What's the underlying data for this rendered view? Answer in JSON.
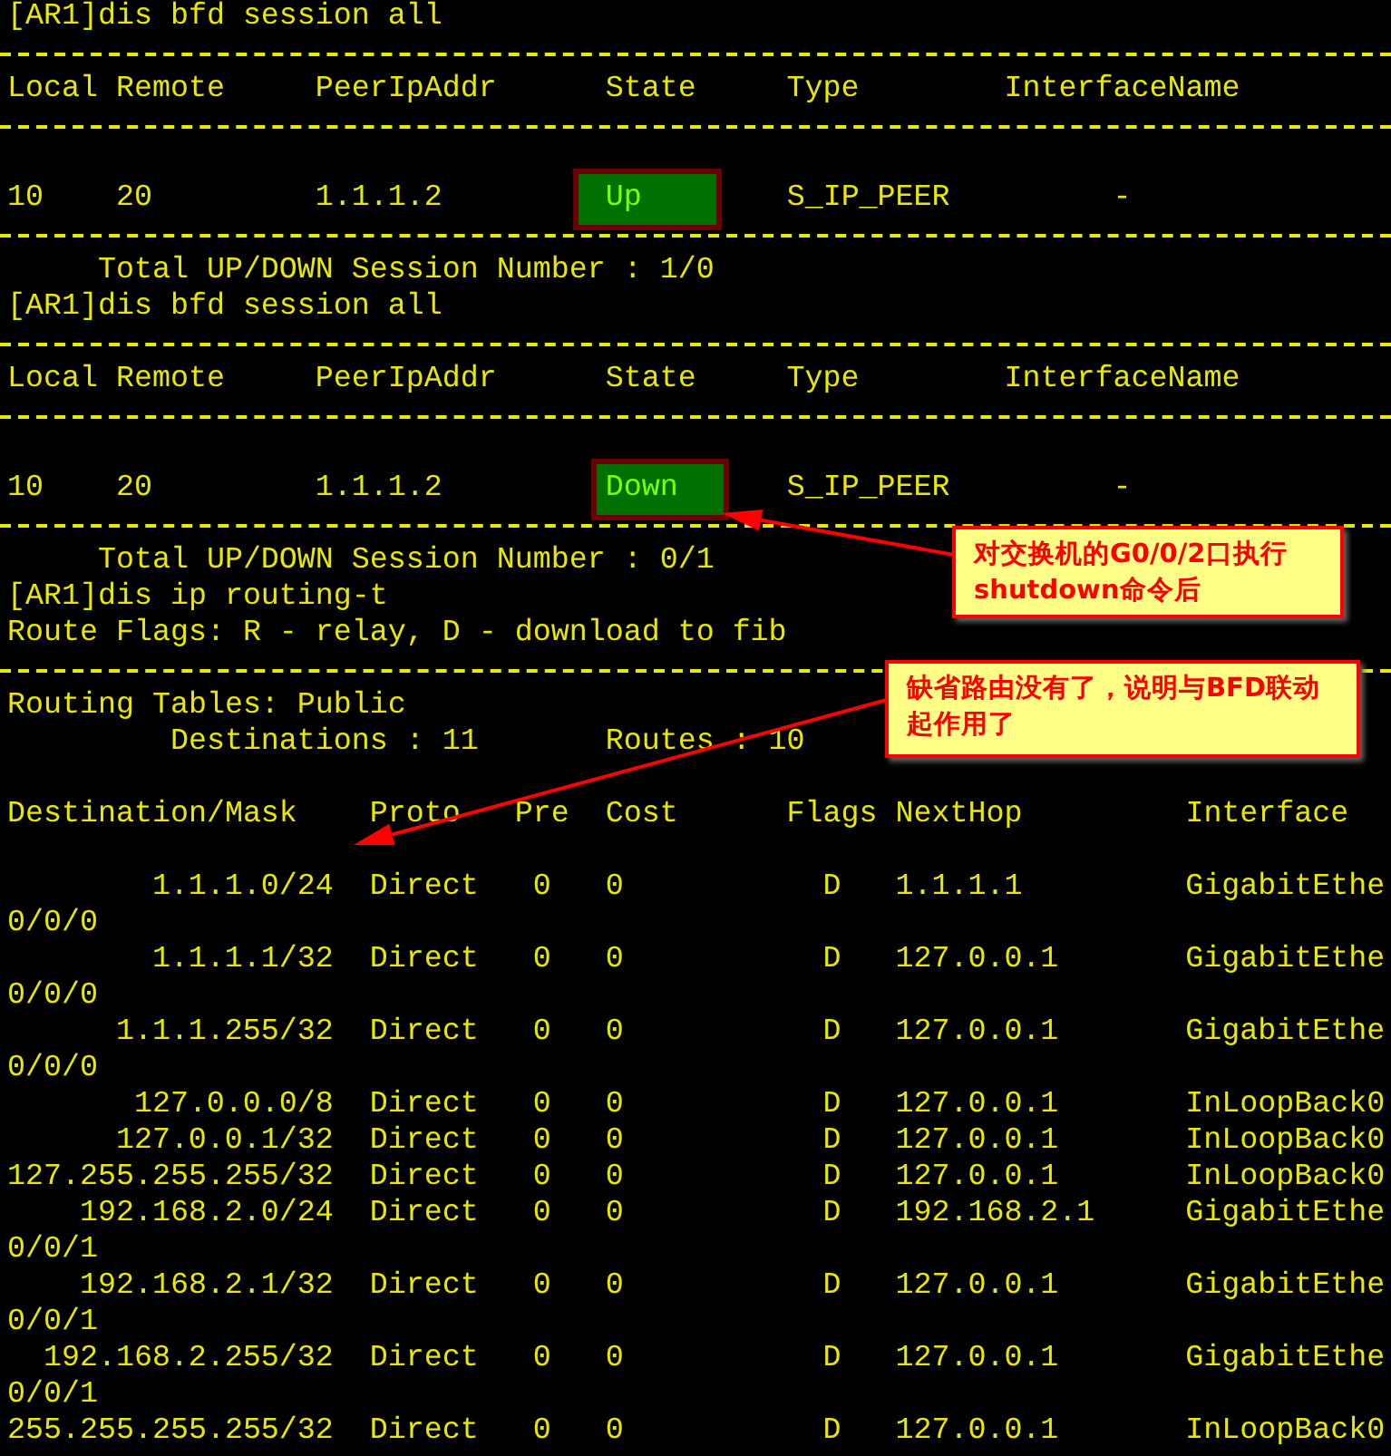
{
  "terminal": {
    "lines": [
      {
        "kind": "text",
        "text": "[AR1]dis bfd session all"
      },
      {
        "kind": "rule"
      },
      {
        "kind": "text",
        "text": "Local Remote     PeerIpAddr      State     Type        InterfaceName"
      },
      {
        "kind": "rule"
      },
      {
        "kind": "blank"
      },
      {
        "kind": "bfd_row",
        "local": "10",
        "remote": "20",
        "peer": "1.1.1.2",
        "state": "Up",
        "type": "S_IP_PEER",
        "interface": "-"
      },
      {
        "kind": "rule"
      },
      {
        "kind": "text",
        "text": "     Total UP/DOWN Session Number : 1/0"
      },
      {
        "kind": "text",
        "text": "[AR1]dis bfd session all"
      },
      {
        "kind": "rule"
      },
      {
        "kind": "text",
        "text": "Local Remote     PeerIpAddr      State     Type        InterfaceName"
      },
      {
        "kind": "rule"
      },
      {
        "kind": "blank"
      },
      {
        "kind": "bfd_row",
        "local": "10",
        "remote": "20",
        "peer": "1.1.1.2",
        "state": "Down",
        "type": "S_IP_PEER",
        "interface": "-"
      },
      {
        "kind": "rule"
      },
      {
        "kind": "text",
        "text": "     Total UP/DOWN Session Number : 0/1"
      },
      {
        "kind": "text",
        "text": "[AR1]dis ip routing-t"
      },
      {
        "kind": "text",
        "text": "Route Flags: R - relay, D - download to fib"
      },
      {
        "kind": "rule"
      },
      {
        "kind": "text",
        "text": "Routing Tables: Public"
      },
      {
        "kind": "text",
        "text": "         Destinations : 11       Routes : 10"
      },
      {
        "kind": "blank"
      },
      {
        "kind": "text",
        "text": "Destination/Mask    Proto   Pre  Cost      Flags NextHop         Interface"
      },
      {
        "kind": "blank"
      },
      {
        "kind": "route_row",
        "dest": "1.1.1.0/24",
        "proto": "Direct",
        "pre": "0",
        "cost": "0",
        "flags": "D",
        "nexthop": "1.1.1.1",
        "interface": "GigabitEthe"
      },
      {
        "kind": "text",
        "text": "0/0/0"
      },
      {
        "kind": "route_row",
        "dest": "1.1.1.1/32",
        "proto": "Direct",
        "pre": "0",
        "cost": "0",
        "flags": "D",
        "nexthop": "127.0.0.1",
        "interface": "GigabitEthe"
      },
      {
        "kind": "text",
        "text": "0/0/0"
      },
      {
        "kind": "route_row",
        "dest": "1.1.1.255/32",
        "proto": "Direct",
        "pre": "0",
        "cost": "0",
        "flags": "D",
        "nexthop": "127.0.0.1",
        "interface": "GigabitEthe"
      },
      {
        "kind": "text",
        "text": "0/0/0"
      },
      {
        "kind": "route_row",
        "dest": "127.0.0.0/8",
        "proto": "Direct",
        "pre": "0",
        "cost": "0",
        "flags": "D",
        "nexthop": "127.0.0.1",
        "interface": "InLoopBack0"
      },
      {
        "kind": "route_row",
        "dest": "127.0.0.1/32",
        "proto": "Direct",
        "pre": "0",
        "cost": "0",
        "flags": "D",
        "nexthop": "127.0.0.1",
        "interface": "InLoopBack0"
      },
      {
        "kind": "route_row",
        "dest": "127.255.255.255/32",
        "proto": "Direct",
        "pre": "0",
        "cost": "0",
        "flags": "D",
        "nexthop": "127.0.0.1",
        "interface": "InLoopBack0"
      },
      {
        "kind": "route_row",
        "dest": "192.168.2.0/24",
        "proto": "Direct",
        "pre": "0",
        "cost": "0",
        "flags": "D",
        "nexthop": "192.168.2.1",
        "interface": "GigabitEthe"
      },
      {
        "kind": "text",
        "text": "0/0/1"
      },
      {
        "kind": "route_row",
        "dest": "192.168.2.1/32",
        "proto": "Direct",
        "pre": "0",
        "cost": "0",
        "flags": "D",
        "nexthop": "127.0.0.1",
        "interface": "GigabitEthe"
      },
      {
        "kind": "text",
        "text": "0/0/1"
      },
      {
        "kind": "route_row",
        "dest": "192.168.2.255/32",
        "proto": "Direct",
        "pre": "0",
        "cost": "0",
        "flags": "D",
        "nexthop": "127.0.0.1",
        "interface": "GigabitEthe"
      },
      {
        "kind": "text",
        "text": "0/0/1"
      },
      {
        "kind": "route_row",
        "dest": "255.255.255.255/32",
        "proto": "Direct",
        "pre": "0",
        "cost": "0",
        "flags": "D",
        "nexthop": "127.0.0.1",
        "interface": "InLoopBack0"
      }
    ]
  },
  "callouts": [
    {
      "text": "对交换机的G0/0/2口执行shutdown命令后"
    },
    {
      "text": "缺省路由没有了，说明与BFD联动起作用了"
    }
  ]
}
